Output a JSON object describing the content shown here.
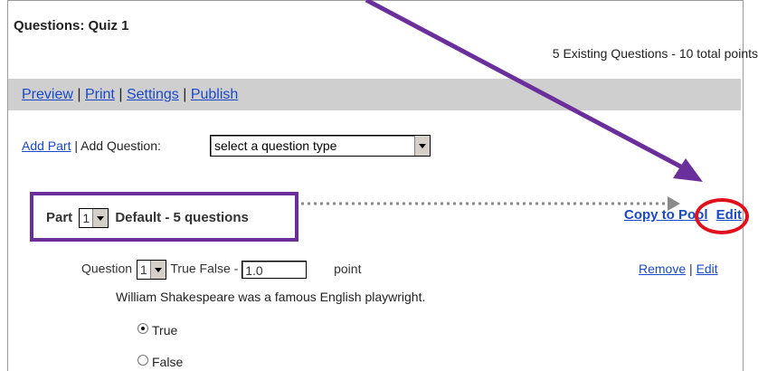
{
  "header": {
    "title": "Questions: Quiz 1",
    "existing_summary": "5 Existing Questions - 10 total points"
  },
  "toolbar": {
    "preview": "Preview",
    "print": "Print",
    "settings": "Settings",
    "publish": "Publish",
    "separator": "|"
  },
  "add_row": {
    "add_part": "Add Part",
    "separator": "|",
    "add_question_label": "Add Question:",
    "question_type_selected": "select a question type"
  },
  "part": {
    "label": "Part",
    "number": "1",
    "description": "Default - 5 questions",
    "copy_to_pool": "Copy to Pool",
    "edit": "Edit"
  },
  "question": {
    "label": "Question",
    "number": "1",
    "type": "True False -",
    "points_value": "1.0",
    "points_label": "point",
    "remove": "Remove",
    "separator": "|",
    "edit": "Edit",
    "text": "William Shakespeare was a famous English playwright.",
    "options": [
      {
        "label": "True",
        "selected": true
      },
      {
        "label": "False",
        "selected": false
      }
    ]
  },
  "annotations": {
    "arrow_color": "#6b2f9b",
    "highlight_box_color": "#6b2f9b",
    "circle_color": "#e0101c",
    "dotted_arrow_color": "#808080"
  }
}
